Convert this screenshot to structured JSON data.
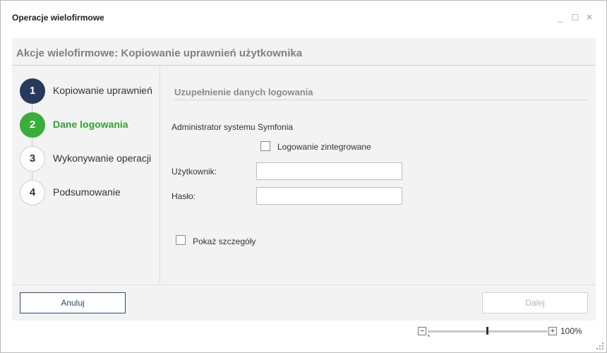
{
  "window": {
    "title": "Operacje wielofirmowe",
    "controls": {
      "minimize": "_",
      "maximize": "☐",
      "close": "×"
    }
  },
  "header": {
    "title": "Akcje wielofirmowe: Kopiowanie uprawnień użytkownika"
  },
  "steps": [
    {
      "number": "1",
      "label": "Kopiowanie uprawnień",
      "state": "done"
    },
    {
      "number": "2",
      "label": "Dane logowania",
      "state": "active"
    },
    {
      "number": "3",
      "label": "Wykonywanie operacji",
      "state": "pending"
    },
    {
      "number": "4",
      "label": "Podsumowanie",
      "state": "pending"
    }
  ],
  "form": {
    "section_title": "Uzupełnienie danych logowania",
    "admin_text": "Administrator systemu Symfonia",
    "integrated_login": {
      "label": "Logowanie zintegrowane",
      "checked": false
    },
    "user_label": "Użytkownik:",
    "user_value": "",
    "password_label": "Hasło:",
    "password_value": "",
    "show_details": {
      "label": "Pokaż szczegóły",
      "checked": false
    }
  },
  "footer": {
    "cancel_label": "Anuluj",
    "next_label": "Dalej"
  },
  "zoom": {
    "minus": "−",
    "plus": "+",
    "value": "100%"
  },
  "colors": {
    "step_done": "#263a5e",
    "step_active": "#3aae3a",
    "cancel_border": "#2a4a7a"
  }
}
